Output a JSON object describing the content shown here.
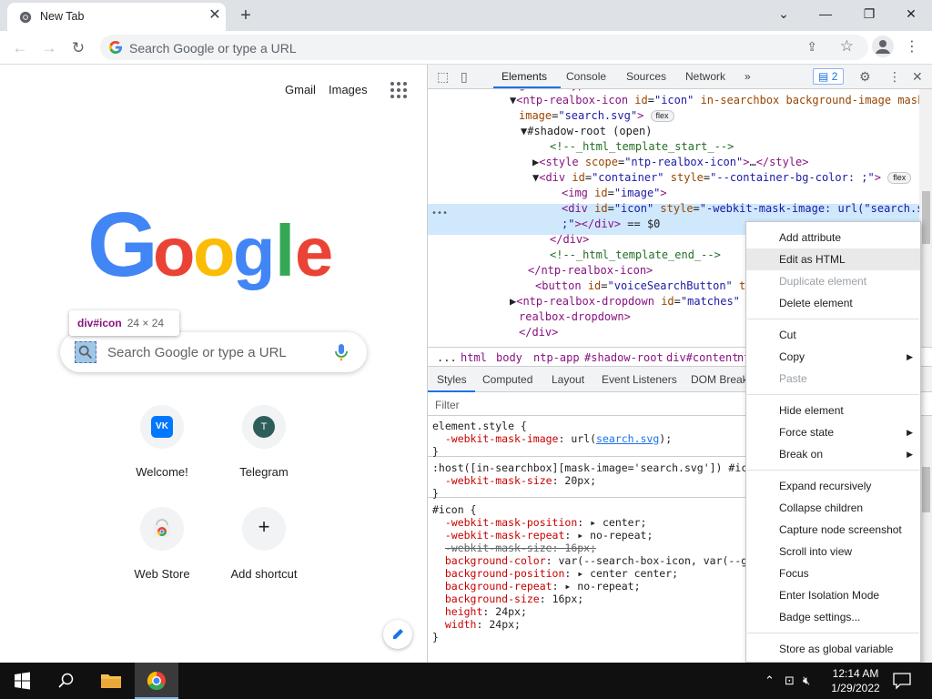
{
  "browser": {
    "tab_title": "New Tab",
    "omnibox_placeholder": "Search Google or type a URL"
  },
  "ntp": {
    "gmail": "Gmail",
    "images": "Images",
    "search_placeholder": "Search Google or type a URL",
    "tooltip_selector": "div#icon",
    "tooltip_size": "24 × 24",
    "shortcuts": [
      {
        "label": "Welcome!",
        "initial": "VK"
      },
      {
        "label": "Telegram",
        "initial": "T"
      },
      {
        "label": "Web Store",
        "initial": ""
      },
      {
        "label": "Add shortcut",
        "initial": "+"
      }
    ]
  },
  "devtools": {
    "tabs": [
      "Elements",
      "Console",
      "Sources",
      "Network"
    ],
    "more": "»",
    "issues_count": "2",
    "dom_lines": [
      {
        "html": "<span class='tg'>gle or type a URL\"</span><span class='tg'>&gt;</span>"
      },
      {
        "html": "▼<span class='tg'>&lt;ntp-realbox-icon</span> <span class='an'>id</span>=<span class='av'>\"icon\"</span> <span class='an'>in-searchbox background-image mask-</span>"
      },
      {
        "html": "<span class='an'>image</span>=<span class='av'>\"search.svg\"</span><span class='tg'>&gt;</span> <span class='badge'>flex</span>"
      },
      {
        "html": "▼<span class='tx'>#shadow-root (open)</span>"
      },
      {
        "html": "<span class='cm'>&lt;!--_html_template_start_--&gt;</span>"
      },
      {
        "html": "▶<span class='tg'>&lt;style</span> <span class='an'>scope</span>=<span class='av'>\"ntp-realbox-icon\"</span><span class='tg'>&gt;</span>…<span class='tg'>&lt;/style&gt;</span>"
      },
      {
        "html": "▼<span class='tg'>&lt;div</span> <span class='an'>id</span>=<span class='av'>\"container\"</span> <span class='an'>style</span>=<span class='av'>\"--container-bg-color: ;\"</span><span class='tg'>&gt;</span> <span class='badge'>flex</span>"
      },
      {
        "html": "<span class='tg'>&lt;img</span> <span class='an'>id</span>=<span class='av'>\"image\"</span><span class='tg'>&gt;</span>"
      },
      {
        "html": "<span class='tg'>&lt;div</span> <span class='an'>id</span>=<span class='av'>\"icon\"</span> <span class='an'>style</span>=<span class='av'>\"-webkit-mask-image: url(\"search.svg\")</span>"
      },
      {
        "html": "<span class='av'>;\"</span><span class='tg'>&gt;&lt;/div&gt;</span> <span class='tx'>== $0</span>"
      },
      {
        "html": "<span class='tg'>&lt;/div&gt;</span>"
      },
      {
        "html": "<span class='cm'>&lt;!--_html_template_end_--&gt;</span>"
      },
      {
        "html": "<span class='tg'>&lt;/ntp-realbox-icon&gt;</span>"
      },
      {
        "html": "<span class='tg'>&lt;button</span> <span class='an'>id</span>=<span class='av'>\"voiceSearchButton\"</span> <span class='an'>title</span>"
      },
      {
        "html": "▶<span class='tg'>&lt;ntp-realbox-dropdown</span> <span class='an'>id</span>=<span class='av'>\"matches\"</span> <span class='an'>ro</span>"
      },
      {
        "html": "<span class='tg'>realbox-dropdown&gt;</span>"
      },
      {
        "html": "<span class='tg'>&lt;/div&gt;</span>"
      }
    ],
    "crumbs": [
      "...",
      "html",
      "body",
      "ntp-app",
      "#shadow-root",
      "div#content",
      "nt"
    ],
    "styles_tabs": [
      "Styles",
      "Computed",
      "Layout",
      "Event Listeners",
      "DOM Break"
    ],
    "filter_placeholder": "Filter",
    "style_lines": [
      {
        "html": "<span class='sel-txt'>element.style {</span>"
      },
      {
        "html": "&nbsp;&nbsp;<span class='prop'>-webkit-mask-image</span>: <span class='val'>url(<span class='lnk'>search.svg</span>);</span>"
      },
      {
        "html": "<span class='sel-txt'>}</span>"
      },
      {
        "html": "<span class='sel-txt'>:host([in-searchbox][mask-image='search.svg']) #icon</span>"
      },
      {
        "html": "&nbsp;&nbsp;<span class='prop'>-webkit-mask-size</span>: <span class='val'>20px;</span>"
      },
      {
        "html": "<span class='sel-txt'>}</span>"
      },
      {
        "html": "<span class='sel-txt'>#icon {</span>"
      },
      {
        "html": "&nbsp;&nbsp;<span class='prop'>-webkit-mask-position</span>: <span class='val'>▸ center;</span>"
      },
      {
        "html": "&nbsp;&nbsp;<span class='prop'>-webkit-mask-repeat</span>: <span class='val'>▸ no-repeat;</span>"
      },
      {
        "html": "&nbsp;&nbsp;<span class='strike'>-webkit-mask-size: 16px;</span>"
      },
      {
        "html": "&nbsp;&nbsp;<span class='prop'>background-color</span>: <span class='val'>var(--search-box-icon, var(--goo</span>"
      },
      {
        "html": "&nbsp;&nbsp;<span class='prop'>background-position</span>: <span class='val'>▸ center center;</span>"
      },
      {
        "html": "&nbsp;&nbsp;<span class='prop'>background-repeat</span>: <span class='val'>▸ no-repeat;</span>"
      },
      {
        "html": "&nbsp;&nbsp;<span class='prop'>background-size</span>: <span class='val'>16px;</span>"
      },
      {
        "html": "&nbsp;&nbsp;<span class='prop'>height</span>: <span class='val'>24px;</span>"
      },
      {
        "html": "&nbsp;&nbsp;<span class='prop'>width</span>: <span class='val'>24px;</span>"
      },
      {
        "html": "<span class='sel-txt'>}</span>"
      }
    ]
  },
  "context_menu": {
    "items": [
      {
        "label": "Add attribute",
        "disabled": false,
        "submenu": false
      },
      {
        "label": "Edit as HTML",
        "disabled": false,
        "submenu": false,
        "hover": true
      },
      {
        "label": "Duplicate element",
        "disabled": true,
        "submenu": false
      },
      {
        "label": "Delete element",
        "disabled": false,
        "submenu": false
      },
      {
        "sep": true
      },
      {
        "label": "Cut",
        "disabled": false,
        "submenu": false
      },
      {
        "label": "Copy",
        "disabled": false,
        "submenu": true
      },
      {
        "label": "Paste",
        "disabled": true,
        "submenu": false
      },
      {
        "sep": true
      },
      {
        "label": "Hide element",
        "disabled": false,
        "submenu": false
      },
      {
        "label": "Force state",
        "disabled": false,
        "submenu": true
      },
      {
        "label": "Break on",
        "disabled": false,
        "submenu": true
      },
      {
        "sep": true
      },
      {
        "label": "Expand recursively",
        "disabled": false,
        "submenu": false
      },
      {
        "label": "Collapse children",
        "disabled": false,
        "submenu": false
      },
      {
        "label": "Capture node screenshot",
        "disabled": false,
        "submenu": false
      },
      {
        "label": "Scroll into view",
        "disabled": false,
        "submenu": false
      },
      {
        "label": "Focus",
        "disabled": false,
        "submenu": false
      },
      {
        "label": "Enter Isolation Mode",
        "disabled": false,
        "submenu": false
      },
      {
        "label": "Badge settings...",
        "disabled": false,
        "submenu": false
      },
      {
        "sep": true
      },
      {
        "label": "Store as global variable",
        "disabled": false,
        "submenu": false
      }
    ]
  },
  "taskbar": {
    "time": "12:14 AM",
    "date": "1/29/2022"
  },
  "colors": {
    "accent": "#1a73e8",
    "dom_selected": "#cfe8fc",
    "tag": "#881280",
    "attr_name": "#994500",
    "attr_value": "#1a1aa6",
    "comment": "#236e25",
    "css_prop": "#c80000"
  }
}
